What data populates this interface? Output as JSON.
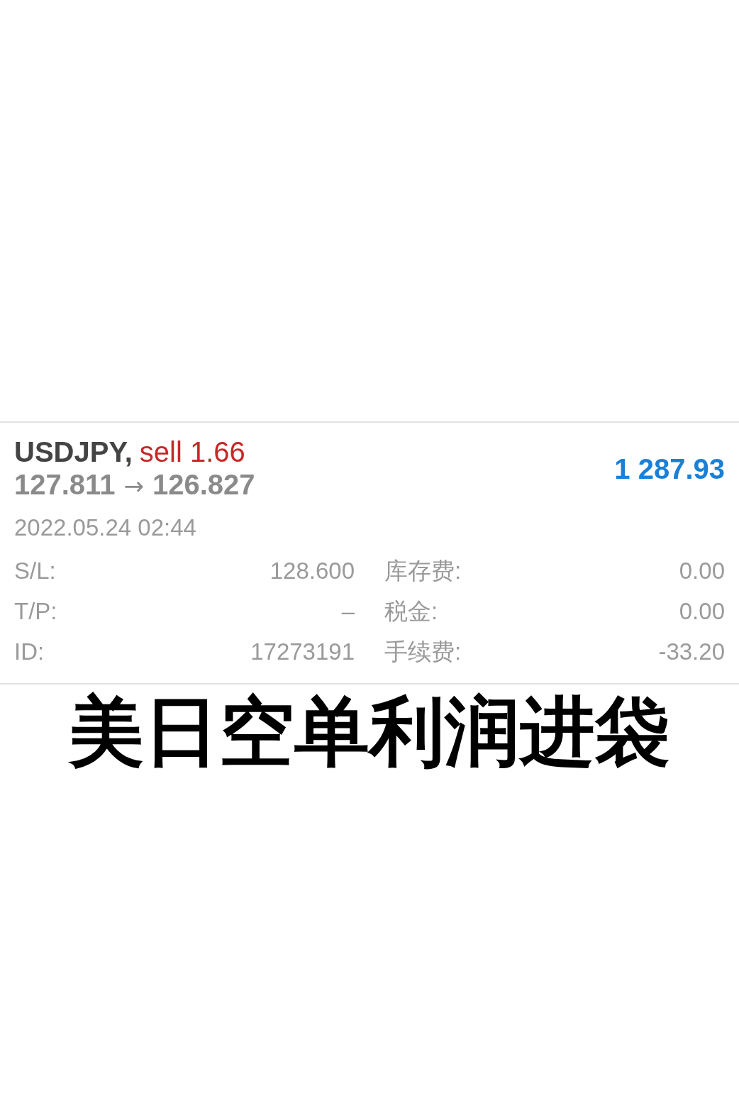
{
  "trade": {
    "symbol": "USDJPY,",
    "side": "sell 1.66",
    "open_price": "127.811",
    "arrow": "→",
    "close_price": "126.827",
    "profit": "1 287.93",
    "time": "2022.05.24 02:44",
    "left": [
      {
        "label": "S/L:",
        "value": "128.600"
      },
      {
        "label": "T/P:",
        "value": "–"
      },
      {
        "label": "ID:",
        "value": "17273191"
      }
    ],
    "right": [
      {
        "label": "库存费:",
        "value": "0.00"
      },
      {
        "label": "税金:",
        "value": "0.00"
      },
      {
        "label": "手续费:",
        "value": "-33.20"
      }
    ]
  },
  "caption": "美日空单利润进袋"
}
